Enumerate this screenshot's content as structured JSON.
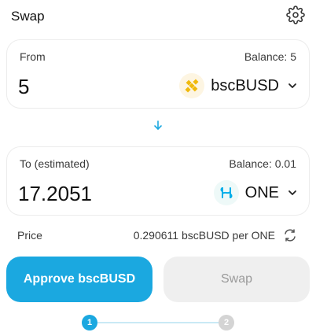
{
  "header": {
    "title": "Swap",
    "settings_icon": "gear-icon"
  },
  "from": {
    "label": "From",
    "balance": "Balance: 5",
    "amount": "5",
    "token": "bscBUSD",
    "token_icon": "busd-token-icon",
    "token_color": "#F0B90B"
  },
  "direction_icon": "arrow-down-icon",
  "to": {
    "label": "To (estimated)",
    "balance": "Balance: 0.01",
    "amount": "17.2051",
    "token": "ONE",
    "token_icon": "harmony-one-token-icon",
    "token_color": "#00AEE9"
  },
  "price": {
    "label": "Price",
    "value": "0.290611 bscBUSD per ONE",
    "toggle_icon": "swap-arrows-icon"
  },
  "buttons": {
    "approve": "Approve bscBUSD",
    "swap": "Swap"
  },
  "steps": [
    "1",
    "2"
  ],
  "colors": {
    "accent": "#1BA8E0",
    "disabled_bg": "#EFEFEF",
    "disabled_text": "#9A9A9A"
  }
}
